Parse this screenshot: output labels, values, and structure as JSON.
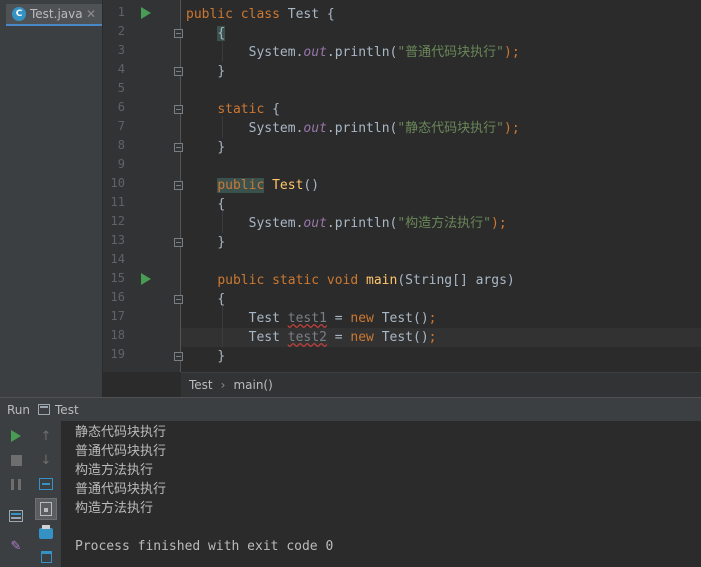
{
  "editor": {
    "tab": {
      "icon_letter": "C",
      "label": "Test.java",
      "close": "✕"
    },
    "line_numbers": [
      "1",
      "2",
      "3",
      "4",
      "5",
      "6",
      "7",
      "8",
      "9",
      "10",
      "11",
      "12",
      "13",
      "14",
      "15",
      "16",
      "17",
      "18",
      "19"
    ],
    "breadcrumb": {
      "class": "Test",
      "method": "main()",
      "separator": "›"
    }
  },
  "code": {
    "l1": {
      "kw": "public class ",
      "rest": "Test {"
    },
    "l2": "{",
    "l3": {
      "pre": "System.",
      "field": "out",
      "mid": ".println(",
      "str": "\"普通代码块执行\"",
      "end": ");"
    },
    "l4": "}",
    "l6": {
      "kw": "static",
      "rest": " {"
    },
    "l7": {
      "pre": "System.",
      "field": "out",
      "mid": ".println(",
      "str": "\"静态代码块执行\"",
      "end": ");"
    },
    "l8": "}",
    "l10": {
      "kw": "public",
      "name": "Test",
      "rest": "()"
    },
    "l11": "{",
    "l12": {
      "pre": "System.",
      "field": "out",
      "mid": ".println(",
      "str": "\"构造方法执行\"",
      "end": ");"
    },
    "l13": "}",
    "l15": {
      "kw": "public static void ",
      "name": "main",
      "rest": "(String[] args)"
    },
    "l16": "{",
    "l17": {
      "type": "Test ",
      "var": "test1",
      "eq": " = ",
      "kw": "new",
      "rest": " Test()",
      "end": ";"
    },
    "l18": {
      "type": "Test ",
      "var": "test2",
      "eq": " = ",
      "kw": "new",
      "rest": " Test()",
      "end": ";"
    },
    "l19": "}"
  },
  "run": {
    "label": "Run",
    "config": "Test",
    "output": [
      "静态代码块执行",
      "普通代码块执行",
      "构造方法执行",
      "普通代码块执行",
      "构造方法执行",
      "",
      "Process finished with exit code 0"
    ]
  },
  "colors": {
    "editor_bg": "#2b2b2b",
    "keyword": "#cc7832",
    "string": "#6a8759",
    "field": "#9876aa",
    "method": "#ffc66d",
    "run_green": "#499c54"
  }
}
